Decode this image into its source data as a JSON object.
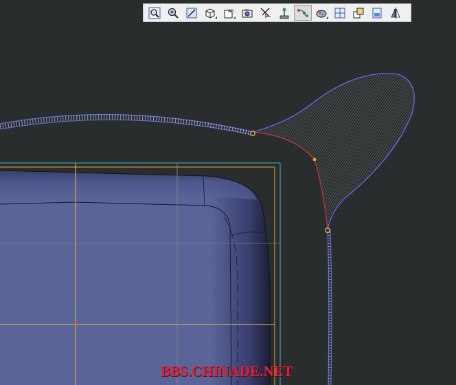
{
  "toolbar": {
    "tools": [
      {
        "name": "fit-all-tool",
        "icon": "magnifier-box-icon",
        "active": false
      },
      {
        "name": "zoom-tool",
        "icon": "magnifier-plus-icon",
        "active": false
      },
      {
        "name": "normal-view-tool",
        "icon": "plane-normal-icon",
        "active": false
      },
      {
        "name": "view-cube-tool",
        "icon": "cube-icon",
        "active": false
      },
      {
        "name": "text-tool",
        "icon": "ab-text-icon",
        "active": false
      },
      {
        "name": "capture-tool",
        "icon": "camera-icon",
        "active": false
      },
      {
        "name": "axis-tool",
        "icon": "axis-icon",
        "active": false
      },
      {
        "name": "tree-tool",
        "icon": "tree-icon",
        "active": false
      },
      {
        "name": "connect-tool",
        "icon": "curve-connect-icon",
        "active": true
      },
      {
        "name": "shading-tool",
        "icon": "render-icon",
        "active": false
      },
      {
        "name": "grid-tool",
        "icon": "grid-icon",
        "active": false
      },
      {
        "name": "window-tool",
        "icon": "window-icon",
        "active": false
      },
      {
        "name": "layout-tool",
        "icon": "layout-icon",
        "active": false
      },
      {
        "name": "mirror-tool",
        "icon": "mirror-icon",
        "active": false
      }
    ]
  },
  "watermark": {
    "text": "BBS.CHINADE.NET"
  },
  "colors": {
    "background": "#2a2d2e",
    "surface": "#5a6498",
    "curve": "#5a6ee8",
    "highlight": "#e8a83a",
    "guide": "#3ab8c0",
    "watermark": "#e0203a"
  }
}
